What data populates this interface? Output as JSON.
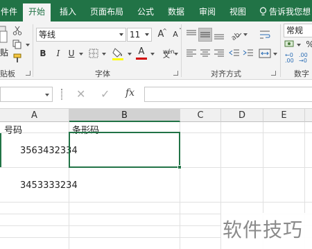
{
  "ribbon": {
    "tabs": [
      "件件",
      "开始",
      "插入",
      "页面布局",
      "公式",
      "数据",
      "审阅",
      "视图"
    ],
    "tell_me": "告诉我您想",
    "font_name": "等线",
    "font_size": "11",
    "number_format": "常规",
    "groups": {
      "clipboard": "贴板",
      "font": "字体",
      "alignment": "对齐方式",
      "number": "数字"
    },
    "paste_label": "贴",
    "bold": "B",
    "italic": "I",
    "underline": "U",
    "grow_font": "A",
    "shrink_font": "A",
    "font_color": "A",
    "wen": "文",
    "percent": "%",
    "dec_increase": ".00 →.0",
    "dec_decrease": ".00 ←.0"
  },
  "formula_bar": {
    "cancel": "✕",
    "enter": "✓",
    "fx": "fx"
  },
  "columns": [
    "A",
    "B",
    "C",
    "D",
    "E"
  ],
  "cells": {
    "a_header": "号码",
    "b_header": "条形码",
    "a2": "3563432334",
    "a3": "3453333234"
  },
  "watermark": "软件技巧"
}
